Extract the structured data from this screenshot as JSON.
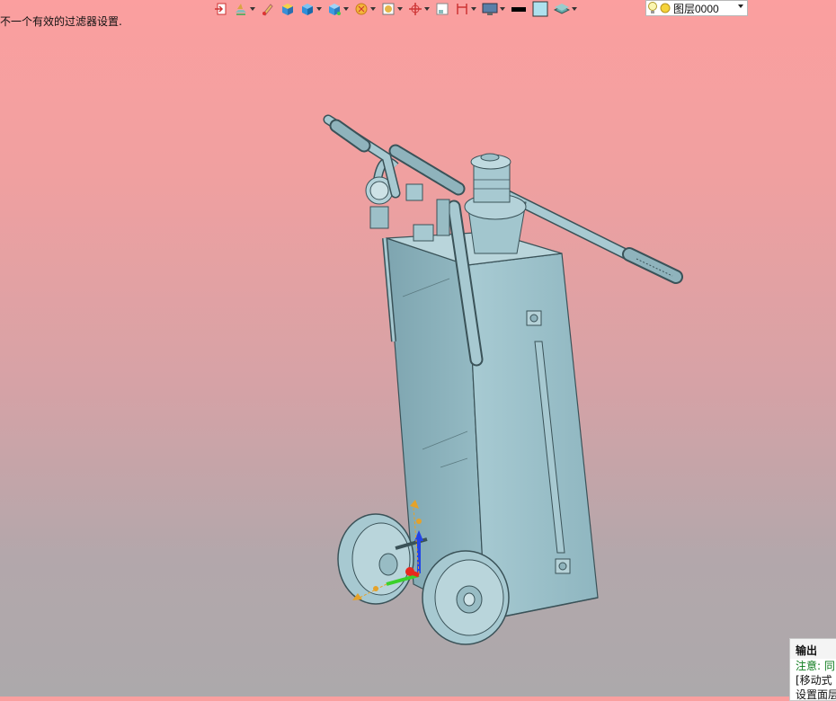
{
  "status_text": "不一个有效的过滤器设置.",
  "toolbar": {
    "icons": [
      "export-icon",
      "layers-stack-icon",
      "paint-icon",
      "box-solid-icon",
      "cube-icon",
      "cube-view-icon",
      "sun-icon",
      "render-icon",
      "axis-icon",
      "frame-icon",
      "dimension-icon",
      "display-icon",
      "color-black-icon",
      "color-fill-icon",
      "layer-icon"
    ]
  },
  "layer_selector": {
    "value": "图层0000"
  },
  "output_panel": {
    "title": "输出",
    "note": "注意: 同",
    "line1": "[移动式",
    "line2": "设置面层"
  },
  "colors": {
    "model": "#9fc3cc",
    "model_edge": "#3a5258",
    "axis_x": "#e8281e",
    "axis_y": "#3ad12a",
    "axis_z": "#2244e8",
    "axis_handle": "#e5a22a"
  }
}
